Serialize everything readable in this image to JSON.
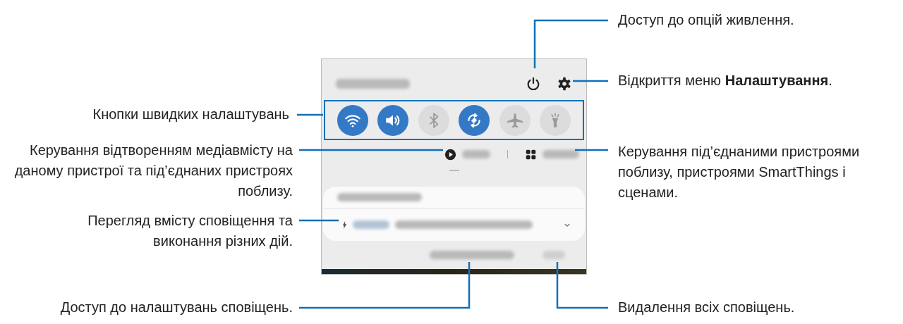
{
  "callouts": {
    "power": {
      "text": "Доступ до опцій живлення."
    },
    "settings": {
      "text": "Відкриття меню **Налаштування**."
    },
    "quick_settings": {
      "text": "Кнопки швидких налаштувань"
    },
    "media": {
      "text": "Керування відтворенням медіавмісту на даному пристрої та під’єднаних пристроях поблизу."
    },
    "devices": {
      "text": "Керування під’єднаними пристроями поблизу, пристроями SmartThings і сценами."
    },
    "notification": {
      "text": "Перегляд вмісту сповіщення та виконання різних дій."
    },
    "notification_settings": {
      "text": "Доступ до налаштувань сповіщень."
    },
    "clear": {
      "text": "Видалення всіх сповіщень."
    }
  },
  "toggles": [
    {
      "kind": "wifi",
      "on": true
    },
    {
      "kind": "sound",
      "on": true
    },
    {
      "kind": "bluetooth",
      "on": false
    },
    {
      "kind": "rotate",
      "on": true
    },
    {
      "kind": "airplane",
      "on": false
    },
    {
      "kind": "flashlight",
      "on": false
    }
  ]
}
